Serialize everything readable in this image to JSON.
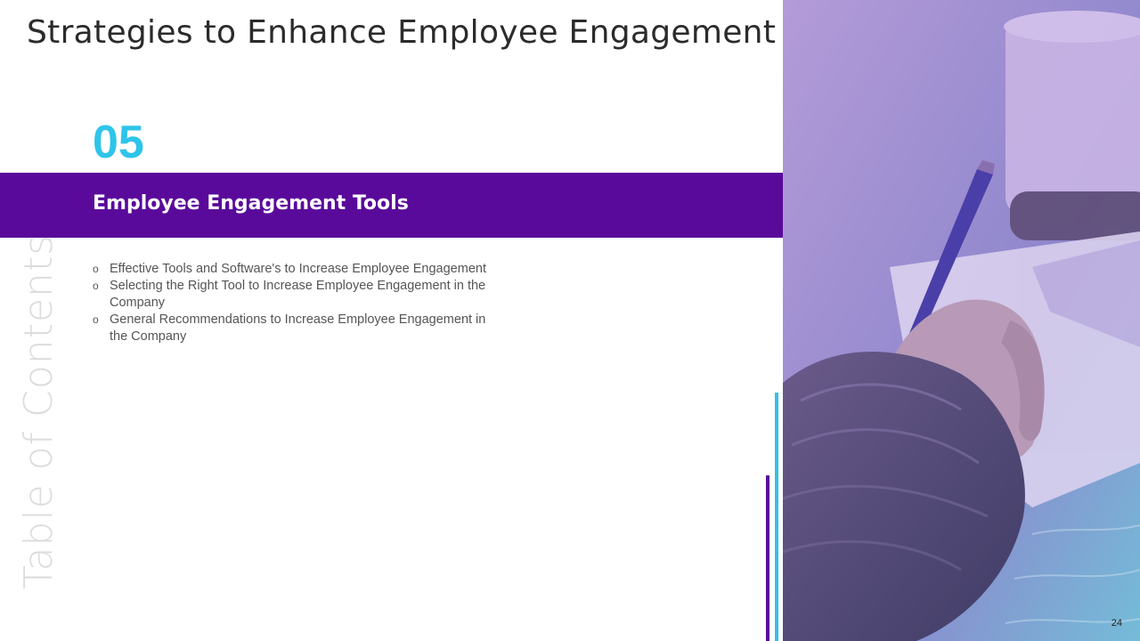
{
  "slide": {
    "title": "Strategies to Enhance Employee Engagement",
    "side_label": "Table of Contents",
    "page_number": "24"
  },
  "section": {
    "number": "05",
    "heading": "Employee Engagement Tools",
    "marker": "o",
    "items": [
      "Effective Tools and Software's to Increase Employee Engagement",
      "Selecting the Right Tool to Increase Employee Engagement in the Company",
      "General Recommendations to Increase Employee Engagement in the Company"
    ]
  },
  "colors": {
    "accent_purple": "#5a0a9a",
    "accent_cyan": "#2fc4ea",
    "title_text": "#2b2b2b",
    "side_label": "#dcdcdc"
  },
  "photo": {
    "description_icon": "hand-writing-photo"
  }
}
